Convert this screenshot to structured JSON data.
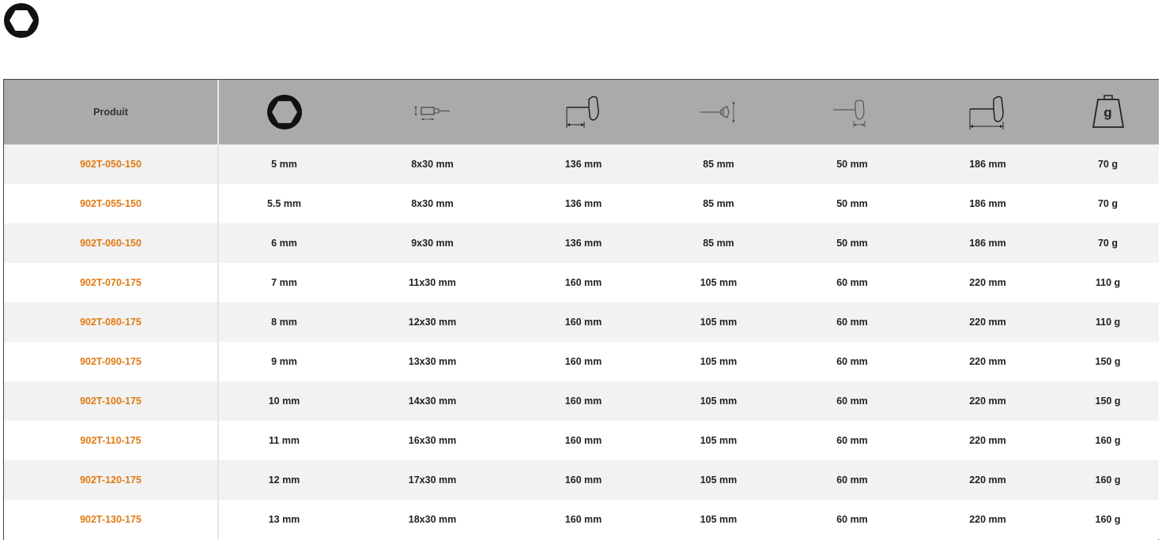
{
  "header": {
    "product_label": "Produit",
    "columns": [
      {
        "icon": "hex-socket-icon"
      },
      {
        "icon": "hex-bit-dimension-icon"
      },
      {
        "icon": "t-handle-blade-length-icon"
      },
      {
        "icon": "t-handle-height-icon"
      },
      {
        "icon": "t-handle-width-icon"
      },
      {
        "icon": "t-handle-total-length-icon"
      },
      {
        "icon": "weight-icon",
        "label": "g"
      }
    ]
  },
  "rows": [
    {
      "product": "902T-050-150",
      "values": [
        "5 mm",
        "8x30 mm",
        "136 mm",
        "85 mm",
        "50 mm",
        "186 mm",
        "70 g"
      ]
    },
    {
      "product": "902T-055-150",
      "values": [
        "5.5 mm",
        "8x30 mm",
        "136 mm",
        "85 mm",
        "50 mm",
        "186 mm",
        "70 g"
      ]
    },
    {
      "product": "902T-060-150",
      "values": [
        "6 mm",
        "9x30 mm",
        "136 mm",
        "85 mm",
        "50 mm",
        "186 mm",
        "70 g"
      ]
    },
    {
      "product": "902T-070-175",
      "values": [
        "7 mm",
        "11x30 mm",
        "160 mm",
        "105 mm",
        "60 mm",
        "220 mm",
        "110 g"
      ]
    },
    {
      "product": "902T-080-175",
      "values": [
        "8 mm",
        "12x30 mm",
        "160 mm",
        "105 mm",
        "60 mm",
        "220 mm",
        "110 g"
      ]
    },
    {
      "product": "902T-090-175",
      "values": [
        "9 mm",
        "13x30 mm",
        "160 mm",
        "105 mm",
        "60 mm",
        "220 mm",
        "150 g"
      ]
    },
    {
      "product": "902T-100-175",
      "values": [
        "10 mm",
        "14x30 mm",
        "160 mm",
        "105 mm",
        "60 mm",
        "220 mm",
        "150 g"
      ]
    },
    {
      "product": "902T-110-175",
      "values": [
        "11 mm",
        "16x30 mm",
        "160 mm",
        "105 mm",
        "60 mm",
        "220 mm",
        "160 g"
      ]
    },
    {
      "product": "902T-120-175",
      "values": [
        "12 mm",
        "17x30 mm",
        "160 mm",
        "105 mm",
        "60 mm",
        "220 mm",
        "160 g"
      ]
    },
    {
      "product": "902T-130-175",
      "values": [
        "13 mm",
        "18x30 mm",
        "160 mm",
        "105 mm",
        "60 mm",
        "220 mm",
        "160 g"
      ]
    }
  ]
}
